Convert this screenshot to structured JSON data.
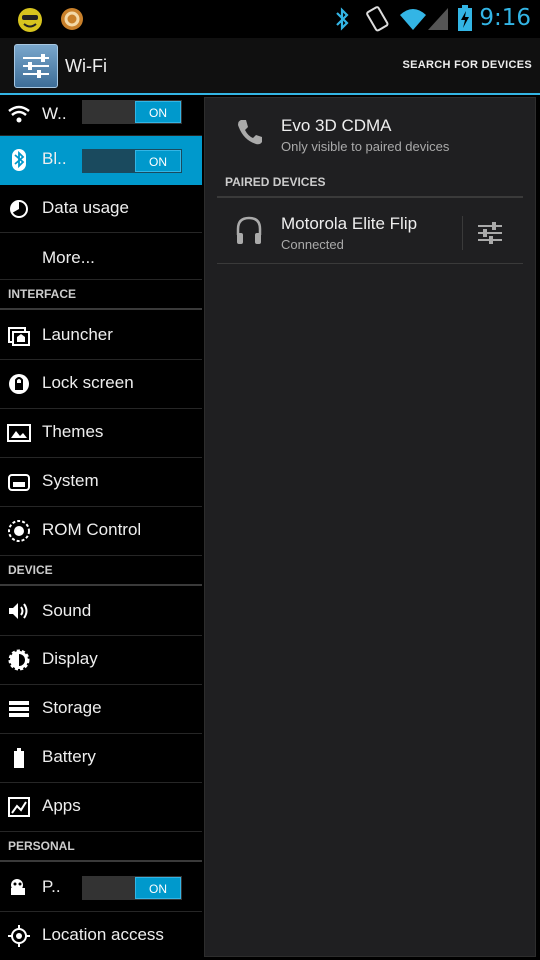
{
  "status_bar": {
    "time": "9:16",
    "icons": [
      "smiley-icon",
      "notification-icon",
      "bluetooth-icon",
      "vibrate-icon",
      "wifi-icon",
      "signal-icon",
      "battery-icon"
    ]
  },
  "action_bar": {
    "title": "Wi-Fi",
    "action": "SEARCH FOR DEVICES"
  },
  "sidebar": {
    "wireless": [
      {
        "label": "W..",
        "toggle": "ON",
        "icon": "wifi-icon"
      },
      {
        "label": "Bl..",
        "toggle": "ON",
        "icon": "bluetooth-icon"
      },
      {
        "label": "Data usage",
        "icon": "data-usage-icon"
      },
      {
        "label": "More...",
        "icon": ""
      }
    ],
    "interface_header": "INTERFACE",
    "interface": [
      {
        "label": "Launcher",
        "icon": "launcher-icon"
      },
      {
        "label": "Lock screen",
        "icon": "lock-icon"
      },
      {
        "label": "Themes",
        "icon": "themes-icon"
      },
      {
        "label": "System",
        "icon": "system-icon"
      },
      {
        "label": "ROM Control",
        "icon": "rom-control-icon"
      }
    ],
    "device_header": "DEVICE",
    "device": [
      {
        "label": "Sound",
        "icon": "sound-icon"
      },
      {
        "label": "Display",
        "icon": "display-icon"
      },
      {
        "label": "Storage",
        "icon": "storage-icon"
      },
      {
        "label": "Battery",
        "icon": "battery-icon"
      },
      {
        "label": "Apps",
        "icon": "apps-icon"
      }
    ],
    "personal_header": "PERSONAL",
    "personal": [
      {
        "label": "P..",
        "toggle": "ON",
        "icon": "pie-icon"
      },
      {
        "label": "Location access",
        "icon": "location-icon"
      }
    ]
  },
  "bluetooth": {
    "this_device": {
      "name": "Evo 3D CDMA",
      "sub": "Only visible to paired devices"
    },
    "paired_header": "PAIRED DEVICES",
    "paired": [
      {
        "name": "Motorola Elite Flip",
        "status": "Connected"
      }
    ]
  },
  "colors": {
    "accent": "#33b5e5",
    "selected": "#0099cc",
    "panel": "#1f1f21"
  }
}
